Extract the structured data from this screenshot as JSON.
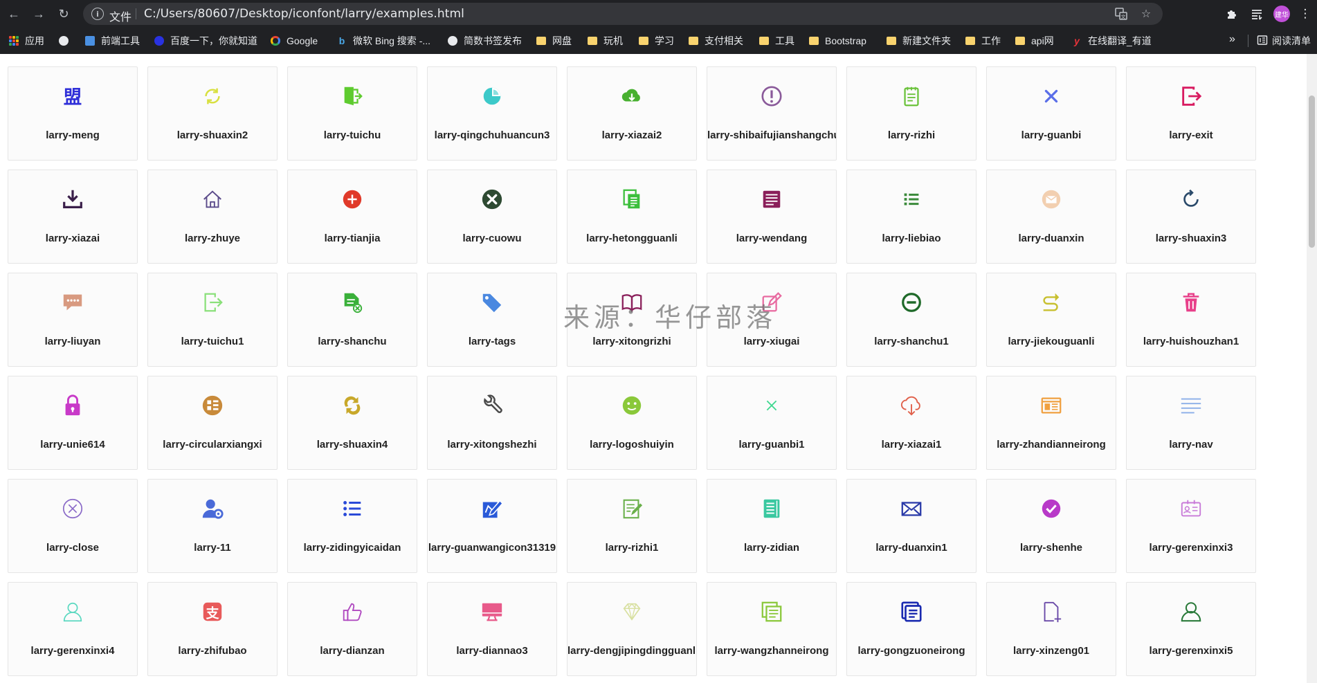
{
  "browser": {
    "scheme_label": "文件",
    "url": "C:/Users/80607/Desktop/iconfont/larry/examples.html",
    "avatar_label": "建华",
    "bookmarks_overflow": "»",
    "reading_list_label": "阅读清单",
    "bookmarks": [
      {
        "label": "应用",
        "icon": "apps-grid-icon"
      },
      {
        "label": "",
        "icon": "globe-icon"
      },
      {
        "label": "前端工具",
        "icon": "site-icon"
      },
      {
        "label": "百度一下，你就知道",
        "icon": "baidu-icon"
      },
      {
        "label": "Google",
        "icon": "google-icon"
      },
      {
        "label": "微软 Bing 搜索 -...",
        "icon": "bing-icon"
      },
      {
        "label": "简数书签发布",
        "icon": "globe-icon"
      },
      {
        "label": "网盘",
        "icon": "folder-icon"
      },
      {
        "label": "玩机",
        "icon": "folder-icon"
      },
      {
        "label": "学习",
        "icon": "folder-icon"
      },
      {
        "label": "支付相关",
        "icon": "folder-icon"
      },
      {
        "label": "工具",
        "icon": "folder-icon"
      },
      {
        "label": "Bootstrap",
        "icon": "folder-icon"
      },
      {
        "label": "新建文件夹",
        "icon": "folder-icon"
      },
      {
        "label": "工作",
        "icon": "folder-icon"
      },
      {
        "label": "api网",
        "icon": "folder-icon"
      },
      {
        "label": "在线翻译_有道",
        "icon": "youdao-icon"
      }
    ]
  },
  "watermark": "来源：华仔部落",
  "icons": [
    {
      "name": "larry-meng",
      "icon": "meng-glyph",
      "color": "#2f2fd8"
    },
    {
      "name": "larry-shuaxin2",
      "icon": "refresh-icon",
      "color": "#d8e040"
    },
    {
      "name": "larry-tuichu",
      "icon": "exit-door-icon",
      "color": "#5ecb2f"
    },
    {
      "name": "larry-qingchuhuancun3",
      "icon": "pie-icon",
      "color": "#3cc9c9"
    },
    {
      "name": "larry-xiazai2",
      "icon": "cloud-download-icon",
      "color": "#48b030"
    },
    {
      "name": "larry-shibaifujianshangchuan",
      "icon": "alert-circle-icon",
      "color": "#8a5a9a"
    },
    {
      "name": "larry-rizhi",
      "icon": "notepad-icon",
      "color": "#6ac23a"
    },
    {
      "name": "larry-guanbi",
      "icon": "x-icon",
      "color": "#5a6ee8"
    },
    {
      "name": "larry-exit",
      "icon": "logout-icon",
      "color": "#d81b60"
    },
    {
      "name": "larry-xiazai",
      "icon": "download-tray-icon",
      "color": "#3a1f4a"
    },
    {
      "name": "larry-zhuye",
      "icon": "home-icon",
      "color": "#5a4a8a"
    },
    {
      "name": "larry-tianjia",
      "icon": "plus-circle-icon",
      "color": "#e03a2a"
    },
    {
      "name": "larry-cuowu",
      "icon": "x-circle-icon",
      "color": "#2e4a32"
    },
    {
      "name": "larry-hetongguanli",
      "icon": "copy-docs-icon",
      "color": "#3cbf3c"
    },
    {
      "name": "larry-wendang",
      "icon": "document-icon",
      "color": "#8a1f5a"
    },
    {
      "name": "larry-liebiao",
      "icon": "list-icon",
      "color": "#3a8a3a"
    },
    {
      "name": "larry-duanxin",
      "icon": "mail-circle-icon",
      "color": "#f2cfb0"
    },
    {
      "name": "larry-shuaxin3",
      "icon": "refresh-ring-icon",
      "color": "#2a4a6a"
    },
    {
      "name": "larry-liuyan",
      "icon": "chat-bubble-icon",
      "color": "#d89a80"
    },
    {
      "name": "larry-tuichu1",
      "icon": "exit-outline-icon",
      "color": "#8ae07a"
    },
    {
      "name": "larry-shanchu",
      "icon": "file-delete-icon",
      "color": "#3ab03a"
    },
    {
      "name": "larry-tags",
      "icon": "tag-icon",
      "color": "#4a88e0"
    },
    {
      "name": "larry-xitongrizhi",
      "icon": "book-icon",
      "color": "#8a1f5a"
    },
    {
      "name": "larry-xiugai",
      "icon": "edit-icon",
      "color": "#e86aa0"
    },
    {
      "name": "larry-shanchu1",
      "icon": "minus-circle-icon",
      "color": "#1f6a2a"
    },
    {
      "name": "larry-jiekouguanli",
      "icon": "route-icon",
      "color": "#c8c030"
    },
    {
      "name": "larry-huishouzhan1",
      "icon": "trash-icon",
      "color": "#e8408a"
    },
    {
      "name": "larry-unie614",
      "icon": "lock-icon",
      "color": "#c83ac8"
    },
    {
      "name": "larry-circularxiangxi",
      "icon": "grid-circle-icon",
      "color": "#c88a3a"
    },
    {
      "name": "larry-shuaxin4",
      "icon": "sync-icon",
      "color": "#c8a82a"
    },
    {
      "name": "larry-xitongshezhi",
      "icon": "wrench-icon",
      "color": "#4a4a4a"
    },
    {
      "name": "larry-logoshuiyin",
      "icon": "face-icon",
      "color": "#8ac83a"
    },
    {
      "name": "larry-guanbi1",
      "icon": "thin-x-icon",
      "color": "#40d890"
    },
    {
      "name": "larry-xiazai1",
      "icon": "cloud-outline-download-icon",
      "color": "#e0604a"
    },
    {
      "name": "larry-zhandianneirong",
      "icon": "newspaper-icon",
      "color": "#f0a040"
    },
    {
      "name": "larry-nav",
      "icon": "menu-lines-icon",
      "color": "#8aaee8"
    },
    {
      "name": "larry-close",
      "icon": "x-circle-outline-icon",
      "color": "#8a6ac8"
    },
    {
      "name": "larry-11",
      "icon": "user-gear-icon",
      "color": "#4a6ad8"
    },
    {
      "name": "larry-zidingyicaidan",
      "icon": "bullet-list-icon",
      "color": "#2a4ad8"
    },
    {
      "name": "larry-guanwangicon31319",
      "icon": "website-edit-icon",
      "color": "#2a5ad8"
    },
    {
      "name": "larry-rizhi1",
      "icon": "note-edit-icon",
      "color": "#6ab04a"
    },
    {
      "name": "larry-zidian",
      "icon": "dictionary-icon",
      "color": "#3ac8a0"
    },
    {
      "name": "larry-duanxin1",
      "icon": "envelope-icon",
      "color": "#2a3aa8"
    },
    {
      "name": "larry-shenhe",
      "icon": "check-circle-icon",
      "color": "#b83ac8"
    },
    {
      "name": "larry-gerenxinxi3",
      "icon": "id-card-icon",
      "color": "#c87ad8"
    },
    {
      "name": "larry-gerenxinxi4",
      "icon": "user-outline-icon",
      "color": "#5ad8c0"
    },
    {
      "name": "larry-zhifubao",
      "icon": "alipay-icon",
      "color": "#e85a5a"
    },
    {
      "name": "larry-dianzan",
      "icon": "thumbs-up-icon",
      "color": "#b04ac0"
    },
    {
      "name": "larry-diannao3",
      "icon": "monitor-icon",
      "color": "#e85a8a"
    },
    {
      "name": "larry-dengjipingdingguanli",
      "icon": "diamond-icon",
      "color": "#d8e0a0"
    },
    {
      "name": "larry-wangzhanneirong",
      "icon": "stack-docs-icon",
      "color": "#8ac83a"
    },
    {
      "name": "larry-gongzuoneirong",
      "icon": "work-docs-icon",
      "color": "#1a2ab0"
    },
    {
      "name": "larry-xinzeng01",
      "icon": "file-plus-icon",
      "color": "#6a4aa8"
    },
    {
      "name": "larry-gerenxinxi5",
      "icon": "user-outline-dark-icon",
      "color": "#2a7a3a"
    }
  ]
}
